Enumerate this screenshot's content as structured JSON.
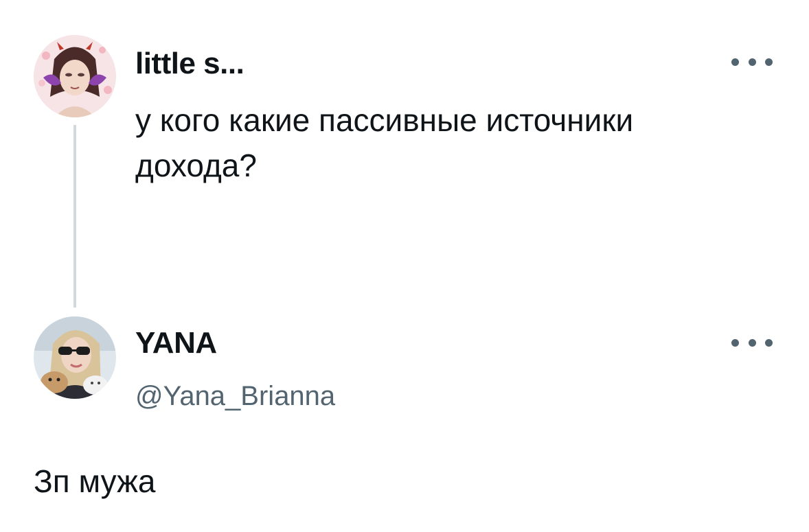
{
  "parent_tweet": {
    "author_name": "little s...",
    "text": "у кого какие пассивные источники\nдохода?",
    "avatar_icon": "avatar-illustration-icon",
    "more_icon": "more-options-icon"
  },
  "reply_tweet": {
    "author_name": "YANA",
    "author_handle": "@Yana_Brianna",
    "text": "Зп мужа",
    "avatar_icon": "avatar-photo-icon",
    "more_icon": "more-options-icon"
  },
  "colors": {
    "text_primary": "#0f1419",
    "text_secondary": "#536471",
    "thread_line": "#cfd9de",
    "background": "#ffffff"
  }
}
